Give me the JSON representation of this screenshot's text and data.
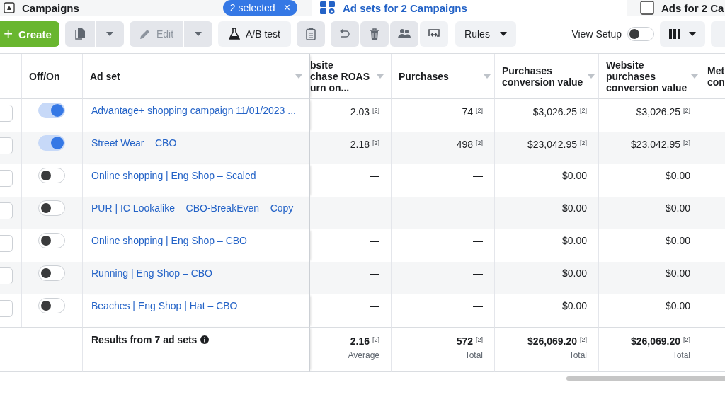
{
  "top_tabs": [
    {
      "label": "Campaigns",
      "selected": false
    },
    {
      "label": "Ad sets for 2 Campaigns",
      "selected": true
    },
    {
      "label": "Ads for 2 Ca",
      "selected": false
    }
  ],
  "selection_chip": {
    "label": "2 selected",
    "close": "×"
  },
  "toolbar": [
    {
      "kind": "create",
      "label": "Create",
      "icon_text": "+",
      "disabled": false
    },
    {
      "kind": "split",
      "disabled": true
    },
    {
      "kind": "split",
      "label": "Edit",
      "disabled": true
    },
    {
      "kind": "button",
      "label": "A/B test",
      "disabled": false
    },
    {
      "kind": "icon",
      "disabled": true
    },
    {
      "kind": "icon",
      "disabled": true
    },
    {
      "kind": "icon",
      "disabled": true
    },
    {
      "kind": "icon",
      "disabled": true
    },
    {
      "kind": "icon",
      "disabled": false
    },
    {
      "kind": "dropdown",
      "label": "Rules",
      "disabled": false
    }
  ],
  "view_setup": {
    "label": "View Setup",
    "on": false
  },
  "table": {
    "columns": [
      "Off/On",
      "Ad set",
      "bsite\nchase ROAS\nurn on...",
      "Purchases",
      "Purchases\nconversion value",
      "Website\npurchases\nconversion value",
      "Met\ncon"
    ],
    "rows": [
      {
        "checked": false,
        "on": true,
        "name": "Advantage+ shopping campaign 11/01/2023 ...",
        "cells": [
          {
            "value": "2.03",
            "note": "[2]"
          },
          {
            "value": "74",
            "note": "[2]"
          },
          {
            "value": "$3,026.25",
            "note": "[2]"
          },
          {
            "value": "$3,026.25",
            "note": "[2]"
          }
        ]
      },
      {
        "checked": false,
        "on": true,
        "name": "Street Wear – CBO",
        "cells": [
          {
            "value": "2.18",
            "note": "[2]"
          },
          {
            "value": "498",
            "note": "[2]"
          },
          {
            "value": "$23,042.95",
            "note": "[2]"
          },
          {
            "value": "$23,042.95",
            "note": "[2]"
          }
        ]
      },
      {
        "checked": false,
        "on": false,
        "name": "Online shopping | Eng Shop – Scaled",
        "cells": [
          {
            "value": "—"
          },
          {
            "value": "—"
          },
          {
            "value": "$0.00"
          },
          {
            "value": "$0.00"
          }
        ]
      },
      {
        "checked": false,
        "on": false,
        "name": "PUR | IC Lookalike – CBO-BreakEven – Copy",
        "cells": [
          {
            "value": "—"
          },
          {
            "value": "—"
          },
          {
            "value": "$0.00"
          },
          {
            "value": "$0.00"
          }
        ]
      },
      {
        "checked": false,
        "on": false,
        "name": "Online shopping | Eng Shop – CBO",
        "cells": [
          {
            "value": "—"
          },
          {
            "value": "—"
          },
          {
            "value": "$0.00"
          },
          {
            "value": "$0.00"
          }
        ]
      },
      {
        "checked": false,
        "on": false,
        "name": "Running | Eng Shop – CBO",
        "cells": [
          {
            "value": "—"
          },
          {
            "value": "—"
          },
          {
            "value": "$0.00"
          },
          {
            "value": "$0.00"
          }
        ]
      },
      {
        "checked": false,
        "on": false,
        "name": "Beaches | Eng Shop | Hat – CBO",
        "cells": [
          {
            "value": "—"
          },
          {
            "value": "—"
          },
          {
            "value": "$0.00"
          },
          {
            "value": "$0.00"
          }
        ]
      }
    ],
    "summary": {
      "label": "Results from 7 ad sets",
      "cells": [
        {
          "value": "2.16",
          "note": "[2]",
          "caption": "Average"
        },
        {
          "value": "572",
          "note": "[2]",
          "caption": "Total"
        },
        {
          "value": "$26,069.20",
          "note": "[2]",
          "caption": "Total"
        },
        {
          "value": "$26,069.20",
          "note": "[2]",
          "caption": "Total"
        }
      ]
    }
  }
}
